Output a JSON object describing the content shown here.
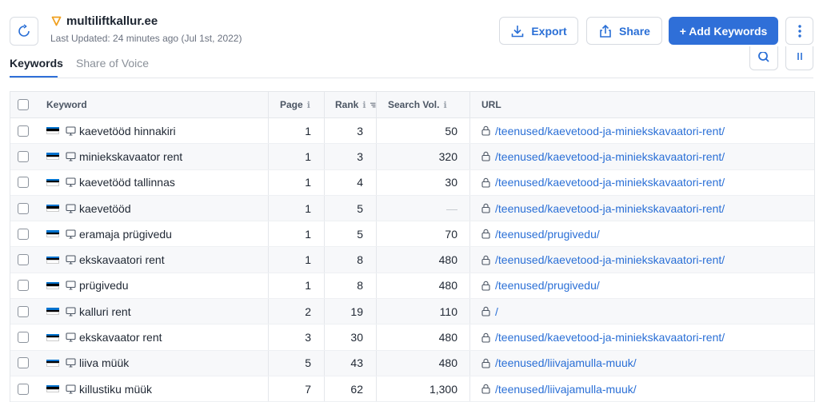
{
  "header": {
    "site_name": "multiliftkallur.ee",
    "last_updated": "Last Updated: 24 minutes ago (Jul 1st, 2022)"
  },
  "buttons": {
    "export": "Export",
    "share": "Share",
    "add_keywords": "+ Add Keywords"
  },
  "tabs": [
    {
      "label": "Keywords",
      "active": true
    },
    {
      "label": "Share of Voice",
      "active": false
    }
  ],
  "table": {
    "columns": {
      "keyword": "Keyword",
      "page": "Page",
      "rank": "Rank",
      "search_vol": "Search Vol.",
      "url": "URL"
    },
    "rows": [
      {
        "keyword": "kaevetööd hinnakiri",
        "page": "1",
        "rank": "3",
        "search_vol": "50",
        "url": "/teenused/kaevetood-ja-miniekskavaatori-rent/"
      },
      {
        "keyword": "miniekskavaator rent",
        "page": "1",
        "rank": "3",
        "search_vol": "320",
        "url": "/teenused/kaevetood-ja-miniekskavaatori-rent/"
      },
      {
        "keyword": "kaevetööd tallinnas",
        "page": "1",
        "rank": "4",
        "search_vol": "30",
        "url": "/teenused/kaevetood-ja-miniekskavaatori-rent/"
      },
      {
        "keyword": "kaevetööd",
        "page": "1",
        "rank": "5",
        "search_vol": "—",
        "url": "/teenused/kaevetood-ja-miniekskavaatori-rent/"
      },
      {
        "keyword": "eramaja prügivedu",
        "page": "1",
        "rank": "5",
        "search_vol": "70",
        "url": "/teenused/prugivedu/"
      },
      {
        "keyword": "ekskavaatori rent",
        "page": "1",
        "rank": "8",
        "search_vol": "480",
        "url": "/teenused/kaevetood-ja-miniekskavaatori-rent/"
      },
      {
        "keyword": "prügivedu",
        "page": "1",
        "rank": "8",
        "search_vol": "480",
        "url": "/teenused/prugivedu/"
      },
      {
        "keyword": "kalluri rent",
        "page": "2",
        "rank": "19",
        "search_vol": "110",
        "url": "/"
      },
      {
        "keyword": "ekskavaator rent",
        "page": "3",
        "rank": "30",
        "search_vol": "480",
        "url": "/teenused/kaevetood-ja-miniekskavaatori-rent/"
      },
      {
        "keyword": "liiva müük",
        "page": "5",
        "rank": "43",
        "search_vol": "480",
        "url": "/teenused/liivajamulla-muuk/"
      },
      {
        "keyword": "killustiku müük",
        "page": "7",
        "rank": "62",
        "search_vol": "1,300",
        "url": "/teenused/liivajamulla-muuk/"
      }
    ]
  },
  "colors": {
    "accent": "#2f6fd8",
    "link": "#2a6fd6",
    "flag": [
      "#0072ce",
      "#000000",
      "#ffffff"
    ]
  },
  "icons": [
    "refresh-icon",
    "location-pin-icon",
    "download-icon",
    "share-icon",
    "more-vertical-icon",
    "search-icon",
    "flag-estonia-icon",
    "desktop-icon",
    "lock-icon",
    "info-icon",
    "sort-icon"
  ]
}
